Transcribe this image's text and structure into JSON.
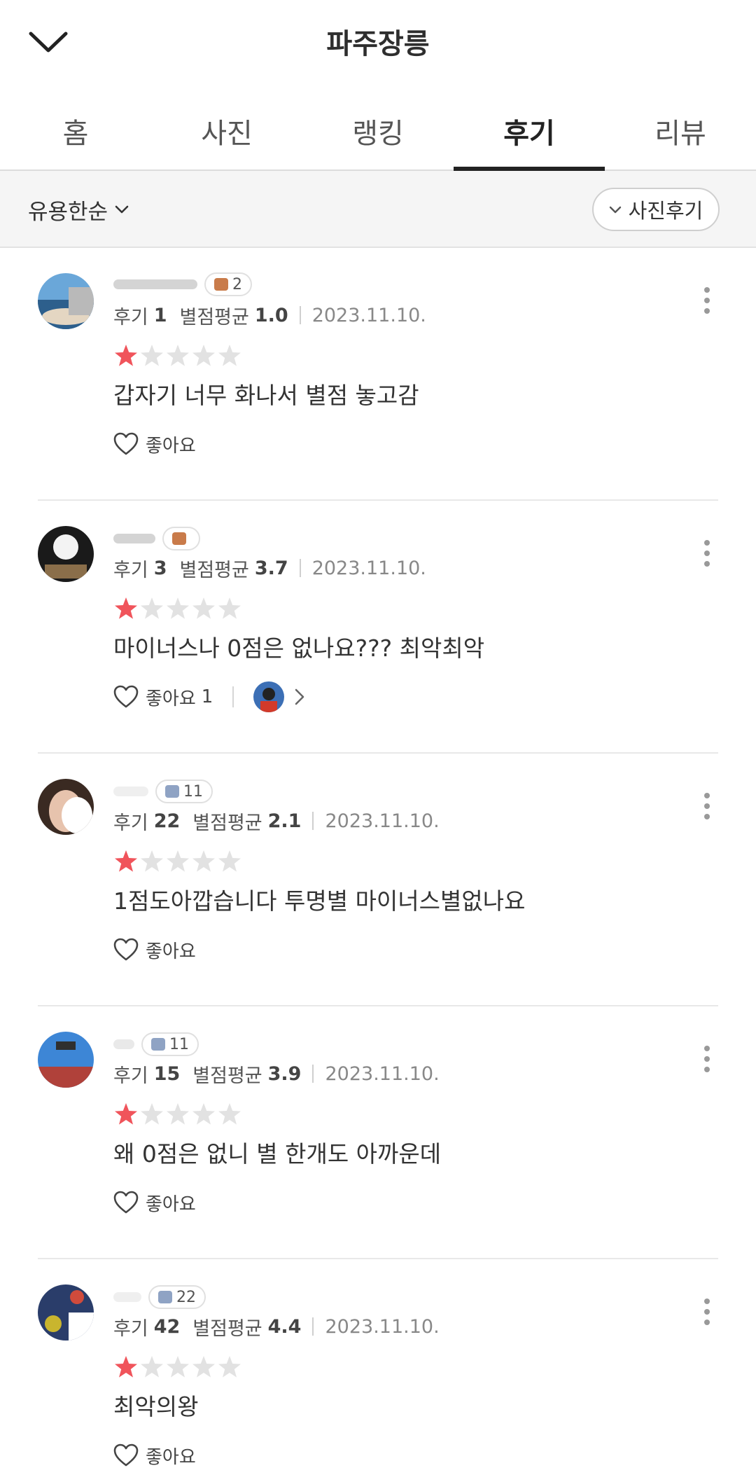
{
  "header": {
    "title": "파주장릉"
  },
  "tabs": [
    {
      "label": "홈"
    },
    {
      "label": "사진"
    },
    {
      "label": "랭킹"
    },
    {
      "label": "후기",
      "active": true
    },
    {
      "label": "리뷰"
    }
  ],
  "filter": {
    "sort_label": "유용한순",
    "photo_filter_label": "사진후기"
  },
  "labels": {
    "reviews": "후기",
    "avg_rating": "별점평균",
    "like": "좋아요"
  },
  "colors": {
    "star_filled": "#f0545b",
    "star_empty": "#e2e2e2",
    "active_tab": "#222222"
  },
  "reviews": [
    {
      "badge": "2",
      "review_count": "1",
      "avg_rating": "1.0",
      "date": "2023.11.10.",
      "rating": 1,
      "content": "갑자기 너무 화나서 별점  놓고감",
      "likes": ""
    },
    {
      "badge": "",
      "review_count": "3",
      "avg_rating": "3.7",
      "date": "2023.11.10.",
      "rating": 1,
      "content": "마이너스나 0점은 없나요??? 최악최악",
      "likes": "1"
    },
    {
      "badge": "11",
      "review_count": "22",
      "avg_rating": "2.1",
      "date": "2023.11.10.",
      "rating": 1,
      "content": "1점도아깝습니다 투명별 마이너스별없나요",
      "likes": ""
    },
    {
      "badge": "11",
      "review_count": "15",
      "avg_rating": "3.9",
      "date": "2023.11.10.",
      "rating": 1,
      "content": "왜 0점은 없니 별 한개도 아까운데",
      "likes": ""
    },
    {
      "badge": "22",
      "review_count": "42",
      "avg_rating": "4.4",
      "date": "2023.11.10.",
      "rating": 1,
      "content": "최악의왕",
      "likes": ""
    }
  ]
}
